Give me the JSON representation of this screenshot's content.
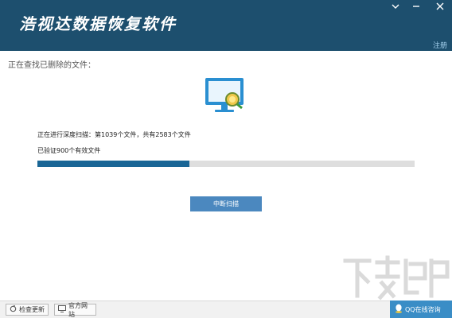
{
  "window": {
    "title": "浩视达数据恢复软件",
    "register_label": "注册"
  },
  "scan": {
    "status": "正在查找已删除的文件：",
    "progress_text": "正在进行深度扫描：第1039个文件，共有2583个文件",
    "verified_text": "已验证900个有效文件",
    "progress_fraction": 0.402,
    "stop_label": "中断扫描"
  },
  "footer": {
    "check_update_label": "检查更新",
    "website_label": "官方网站",
    "qq_label": "QQ在线咨询"
  },
  "colors": {
    "titlebar": "#1d4f6e",
    "progress_fill": "#1a6696",
    "button": "#4b88bf",
    "qq": "#3a8dc6"
  },
  "icons": [
    "menu-icon",
    "minimize-icon",
    "close-icon",
    "monitor-scan-icon",
    "update-icon",
    "website-icon",
    "qq-icon"
  ]
}
